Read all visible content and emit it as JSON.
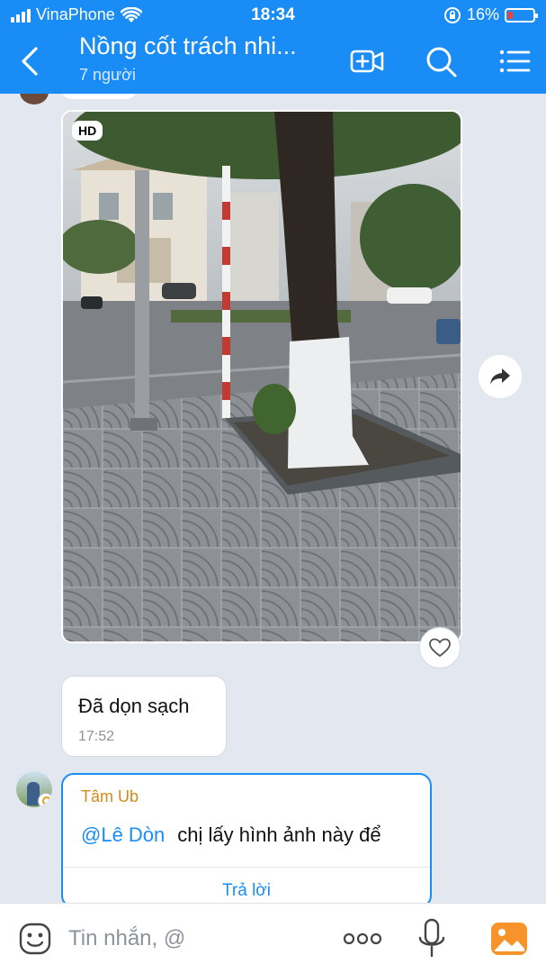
{
  "status_bar": {
    "carrier": "VinaPhone",
    "time": "18:34",
    "battery": "16%"
  },
  "header": {
    "title": "Nồng cốt trách nhi...",
    "subtitle": "7 người"
  },
  "messages": {
    "photo": {
      "badge": "HD"
    },
    "text_message": {
      "text": "Đã dọn sạch",
      "time": "17:52"
    },
    "reply_message": {
      "sender": "Tâm Ub",
      "mention": "@Lê Dòn",
      "text": "chị lấy hình ảnh này để",
      "reply_label": "Trả lời"
    }
  },
  "input_bar": {
    "placeholder": "Tin nhắn, @"
  },
  "colors": {
    "header_blue": "#1a8cf5",
    "chat_bg": "#e3e8f0",
    "sender_name": "#d28a1a",
    "battery_low": "#ff3b30"
  },
  "icons": [
    "signal-icon",
    "wifi-icon",
    "lock-rotation-icon",
    "battery-icon",
    "back-icon",
    "video-call-icon",
    "search-icon",
    "menu-icon",
    "share-icon",
    "heart-icon",
    "emoji-icon",
    "more-icon",
    "mic-icon",
    "gallery-icon"
  ]
}
